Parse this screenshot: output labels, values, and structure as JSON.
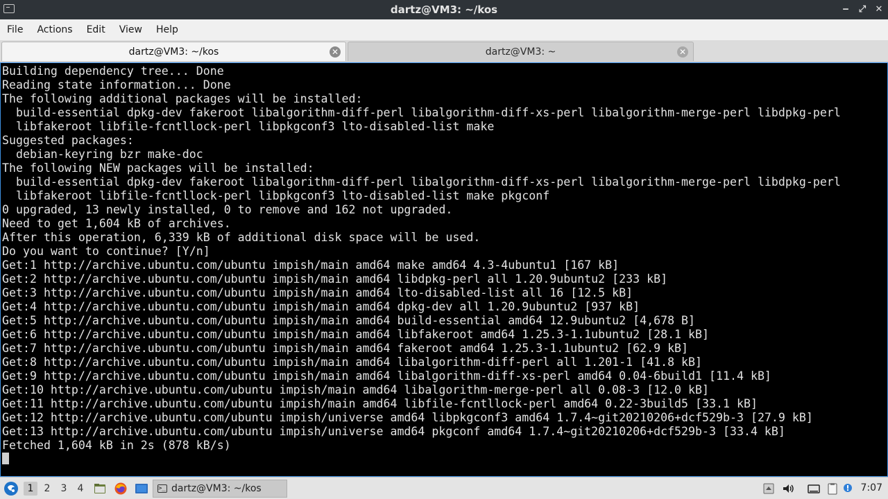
{
  "window": {
    "title": "dartz@VM3: ~/kos",
    "controls": {
      "minimize": "‒",
      "restore": "⤢",
      "close": "✕"
    }
  },
  "menu": [
    "File",
    "Actions",
    "Edit",
    "View",
    "Help"
  ],
  "tabs": [
    {
      "label": "dartz@VM3: ~/kos",
      "active": true
    },
    {
      "label": "dartz@VM3: ~",
      "active": false
    }
  ],
  "terminal": {
    "lines": [
      "Building dependency tree... Done",
      "Reading state information... Done",
      "The following additional packages will be installed:",
      "  build-essential dpkg-dev fakeroot libalgorithm-diff-perl libalgorithm-diff-xs-perl libalgorithm-merge-perl libdpkg-perl",
      "  libfakeroot libfile-fcntllock-perl libpkgconf3 lto-disabled-list make",
      "Suggested packages:",
      "  debian-keyring bzr make-doc",
      "The following NEW packages will be installed:",
      "  build-essential dpkg-dev fakeroot libalgorithm-diff-perl libalgorithm-diff-xs-perl libalgorithm-merge-perl libdpkg-perl",
      "  libfakeroot libfile-fcntllock-perl libpkgconf3 lto-disabled-list make pkgconf",
      "0 upgraded, 13 newly installed, 0 to remove and 162 not upgraded.",
      "Need to get 1,604 kB of archives.",
      "After this operation, 6,339 kB of additional disk space will be used.",
      "Do you want to continue? [Y/n]",
      "Get:1 http://archive.ubuntu.com/ubuntu impish/main amd64 make amd64 4.3-4ubuntu1 [167 kB]",
      "Get:2 http://archive.ubuntu.com/ubuntu impish/main amd64 libdpkg-perl all 1.20.9ubuntu2 [233 kB]",
      "Get:3 http://archive.ubuntu.com/ubuntu impish/main amd64 lto-disabled-list all 16 [12.5 kB]",
      "Get:4 http://archive.ubuntu.com/ubuntu impish/main amd64 dpkg-dev all 1.20.9ubuntu2 [937 kB]",
      "Get:5 http://archive.ubuntu.com/ubuntu impish/main amd64 build-essential amd64 12.9ubuntu2 [4,678 B]",
      "Get:6 http://archive.ubuntu.com/ubuntu impish/main amd64 libfakeroot amd64 1.25.3-1.1ubuntu2 [28.1 kB]",
      "Get:7 http://archive.ubuntu.com/ubuntu impish/main amd64 fakeroot amd64 1.25.3-1.1ubuntu2 [62.9 kB]",
      "Get:8 http://archive.ubuntu.com/ubuntu impish/main amd64 libalgorithm-diff-perl all 1.201-1 [41.8 kB]",
      "Get:9 http://archive.ubuntu.com/ubuntu impish/main amd64 libalgorithm-diff-xs-perl amd64 0.04-6build1 [11.4 kB]",
      "Get:10 http://archive.ubuntu.com/ubuntu impish/main amd64 libalgorithm-merge-perl all 0.08-3 [12.0 kB]",
      "Get:11 http://archive.ubuntu.com/ubuntu impish/main amd64 libfile-fcntllock-perl amd64 0.22-3build5 [33.1 kB]",
      "Get:12 http://archive.ubuntu.com/ubuntu impish/universe amd64 libpkgconf3 amd64 1.7.4~git20210206+dcf529b-3 [27.9 kB]",
      "Get:13 http://archive.ubuntu.com/ubuntu impish/universe amd64 pkgconf amd64 1.7.4~git20210206+dcf529b-3 [33.4 kB]",
      "Fetched 1,604 kB in 2s (878 kB/s)"
    ]
  },
  "panel": {
    "workspaces": [
      "1",
      "2",
      "3",
      "4"
    ],
    "active_workspace": "1",
    "launchers": [
      "file-manager-icon",
      "firefox-icon",
      "show-desktop-icon"
    ],
    "task": {
      "label": "dartz@VM3: ~/kos",
      "icon_glyph": ">_"
    },
    "tray": [
      "removable-media-icon",
      "volume-icon",
      "keyboard-icon",
      "clipboard-icon",
      "update-notifier-icon"
    ],
    "clock": "7:07"
  },
  "colors": {
    "terminal_bg": "#000000",
    "terminal_fg": "#e2e2e2",
    "titlebar_bg": "#2e3338",
    "accent": "#3d8fe0"
  }
}
